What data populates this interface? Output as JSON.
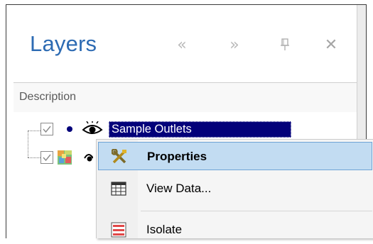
{
  "panel": {
    "title": "Layers",
    "column_header": "Description"
  },
  "toolbar": {
    "prev_icon": "«",
    "next_icon": "»",
    "pin_icon": "⍑",
    "close_icon": "✕"
  },
  "layers": [
    {
      "label": "Sample Outlets",
      "checked": true,
      "selected": true,
      "icon": "point-layer-icon"
    },
    {
      "label": "",
      "checked": true,
      "selected": false,
      "icon": "raster-layer-icon"
    }
  ],
  "context_menu": {
    "items": [
      {
        "label": "Properties",
        "bold": true,
        "highlighted": true,
        "icon": "tools-icon"
      },
      {
        "label": "View Data...",
        "bold": false,
        "highlighted": false,
        "icon": "table-icon"
      },
      {
        "label": "Isolate",
        "bold": false,
        "highlighted": false,
        "icon": "isolate-icon"
      }
    ]
  },
  "colors": {
    "title": "#2d6bb3",
    "selection": "#03017a",
    "menu_highlight": "#c2dcf2"
  }
}
